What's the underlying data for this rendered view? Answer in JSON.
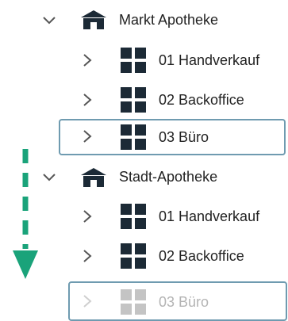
{
  "tree": {
    "groups": [
      {
        "label": "Markt Apotheke",
        "icon": "house-icon",
        "expanded": true,
        "children": [
          {
            "label": "01 Handverkauf",
            "icon": "grid-icon"
          },
          {
            "label": "02 Backoffice",
            "icon": "grid-icon"
          },
          {
            "label": "03 Büro",
            "icon": "grid-icon",
            "state": "dragging"
          }
        ]
      },
      {
        "label": "Stadt-Apotheke",
        "icon": "house-icon",
        "expanded": true,
        "children": [
          {
            "label": "01 Handverkauf",
            "icon": "grid-icon"
          },
          {
            "label": "02 Backoffice",
            "icon": "grid-icon"
          },
          {
            "label": "03 Büro",
            "icon": "grid-icon",
            "state": "drop-preview"
          }
        ]
      }
    ]
  },
  "colors": {
    "text": "#222222",
    "icon": "#1c2a36",
    "chevron": "#555555",
    "selection_border": "#6f9bb0",
    "ghost": "#b4b4b4",
    "drag_arrow": "#1aa37a"
  }
}
